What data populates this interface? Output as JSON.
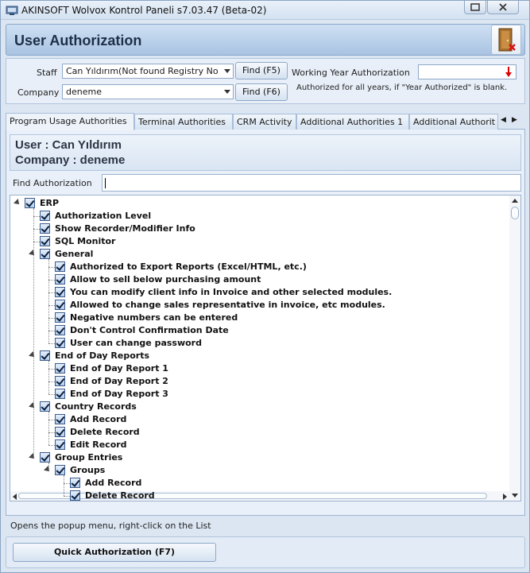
{
  "window": {
    "title": "AKINSOFT Wolvox Kontrol Paneli s7.03.47 (Beta-02)"
  },
  "header": {
    "title": "User Authorization"
  },
  "form": {
    "staff_label": "Staff",
    "staff_value": "Can Yıldırım(Not found Registry No",
    "find_staff": "Find (F5)",
    "company_label": "Company",
    "company_value": "deneme",
    "find_company": "Find (F6)",
    "working_year_label": "Working Year Authorization",
    "working_year_value": "",
    "note": "Authorized for all years, if \"Year Authorized\" is blank."
  },
  "tabs": [
    "Program Usage Authorities",
    "Terminal Authorities",
    "CRM Activity",
    "Additional Authorities 1",
    "Additional Authorit"
  ],
  "userinfo": {
    "user": "User : Can Yıldırım",
    "company": "Company : deneme"
  },
  "find_authorization": {
    "label": "Find Authorization",
    "value": ""
  },
  "tree": [
    {
      "label": "ERP",
      "level": 0,
      "expander": true
    },
    {
      "label": "Authorization Level",
      "level": 1,
      "expander": false
    },
    {
      "label": "Show Recorder/Modifier Info",
      "level": 1,
      "expander": false
    },
    {
      "label": "SQL Monitor",
      "level": 1,
      "expander": false
    },
    {
      "label": "General",
      "level": 1,
      "expander": true
    },
    {
      "label": "Authorized to Export Reports (Excel/HTML, etc.)",
      "level": 2,
      "expander": false
    },
    {
      "label": "Allow to sell below purchasing amount",
      "level": 2,
      "expander": false
    },
    {
      "label": "You can modify client info in Invoice and other selected modules.",
      "level": 2,
      "expander": false
    },
    {
      "label": "Allowed to change sales representative in invoice, etc modules.",
      "level": 2,
      "expander": false
    },
    {
      "label": "Negative numbers can be entered",
      "level": 2,
      "expander": false
    },
    {
      "label": "Don't Control Confirmation Date",
      "level": 2,
      "expander": false
    },
    {
      "label": "User can change password",
      "level": 2,
      "expander": false
    },
    {
      "label": "End of Day Reports",
      "level": 1,
      "expander": true
    },
    {
      "label": "End of Day Report 1",
      "level": 2,
      "expander": false
    },
    {
      "label": "End of Day Report 2",
      "level": 2,
      "expander": false
    },
    {
      "label": "End of Day Report 3",
      "level": 2,
      "expander": false
    },
    {
      "label": "Country Records",
      "level": 1,
      "expander": true
    },
    {
      "label": "Add Record",
      "level": 2,
      "expander": false
    },
    {
      "label": "Delete Record",
      "level": 2,
      "expander": false
    },
    {
      "label": "Edit Record",
      "level": 2,
      "expander": false
    },
    {
      "label": "Group Entries",
      "level": 1,
      "expander": true
    },
    {
      "label": "Groups",
      "level": 2,
      "expander": true
    },
    {
      "label": "Add Record",
      "level": 3,
      "expander": false
    },
    {
      "label": "Delete Record",
      "level": 3,
      "expander": false
    }
  ],
  "status": "Opens the popup menu, right-click on the List",
  "quick_button": "Quick Authorization (F7)"
}
